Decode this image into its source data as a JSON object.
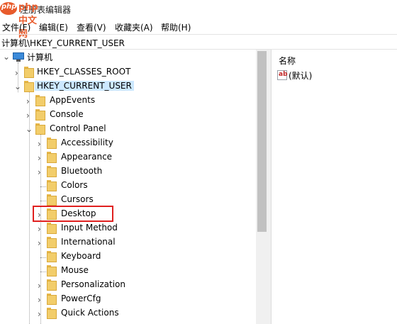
{
  "window": {
    "title": "注册表编辑器",
    "watermark": "php中文网"
  },
  "menu": {
    "items": [
      "文件(F)",
      "编辑(E)",
      "查看(V)",
      "收藏夹(A)",
      "帮助(H)"
    ]
  },
  "address": {
    "path": "计算机\\HKEY_CURRENT_USER"
  },
  "tree": {
    "root": "计算机",
    "nodes": [
      {
        "label": "HKEY_CLASSES_ROOT",
        "expandable": true,
        "expanded": false
      },
      {
        "label": "HKEY_CURRENT_USER",
        "expandable": true,
        "expanded": true,
        "selected": true
      },
      {
        "label": "AppEvents",
        "expandable": true,
        "expanded": false
      },
      {
        "label": "Console",
        "expandable": true,
        "expanded": false
      },
      {
        "label": "Control Panel",
        "expandable": true,
        "expanded": true
      },
      {
        "label": "Accessibility",
        "expandable": true,
        "expanded": false
      },
      {
        "label": "Appearance",
        "expandable": true,
        "expanded": false
      },
      {
        "label": "Bluetooth",
        "expandable": true,
        "expanded": false
      },
      {
        "label": "Colors",
        "expandable": false
      },
      {
        "label": "Cursors",
        "expandable": false
      },
      {
        "label": "Desktop",
        "expandable": true,
        "expanded": false,
        "highlighted": true
      },
      {
        "label": "Input Method",
        "expandable": true,
        "expanded": false
      },
      {
        "label": "International",
        "expandable": true,
        "expanded": false
      },
      {
        "label": "Keyboard",
        "expandable": false
      },
      {
        "label": "Mouse",
        "expandable": false
      },
      {
        "label": "Personalization",
        "expandable": true,
        "expanded": false
      },
      {
        "label": "PowerCfg",
        "expandable": true,
        "expanded": false
      },
      {
        "label": "Quick Actions",
        "expandable": true,
        "expanded": false
      }
    ]
  },
  "values": {
    "column_name": "名称",
    "rows": [
      {
        "name": "(默认)",
        "icon": "string-value-icon"
      }
    ]
  },
  "colors": {
    "selection": "#cce8ff",
    "highlight_box": "#e0201f",
    "folder": "#f2cd6a"
  }
}
